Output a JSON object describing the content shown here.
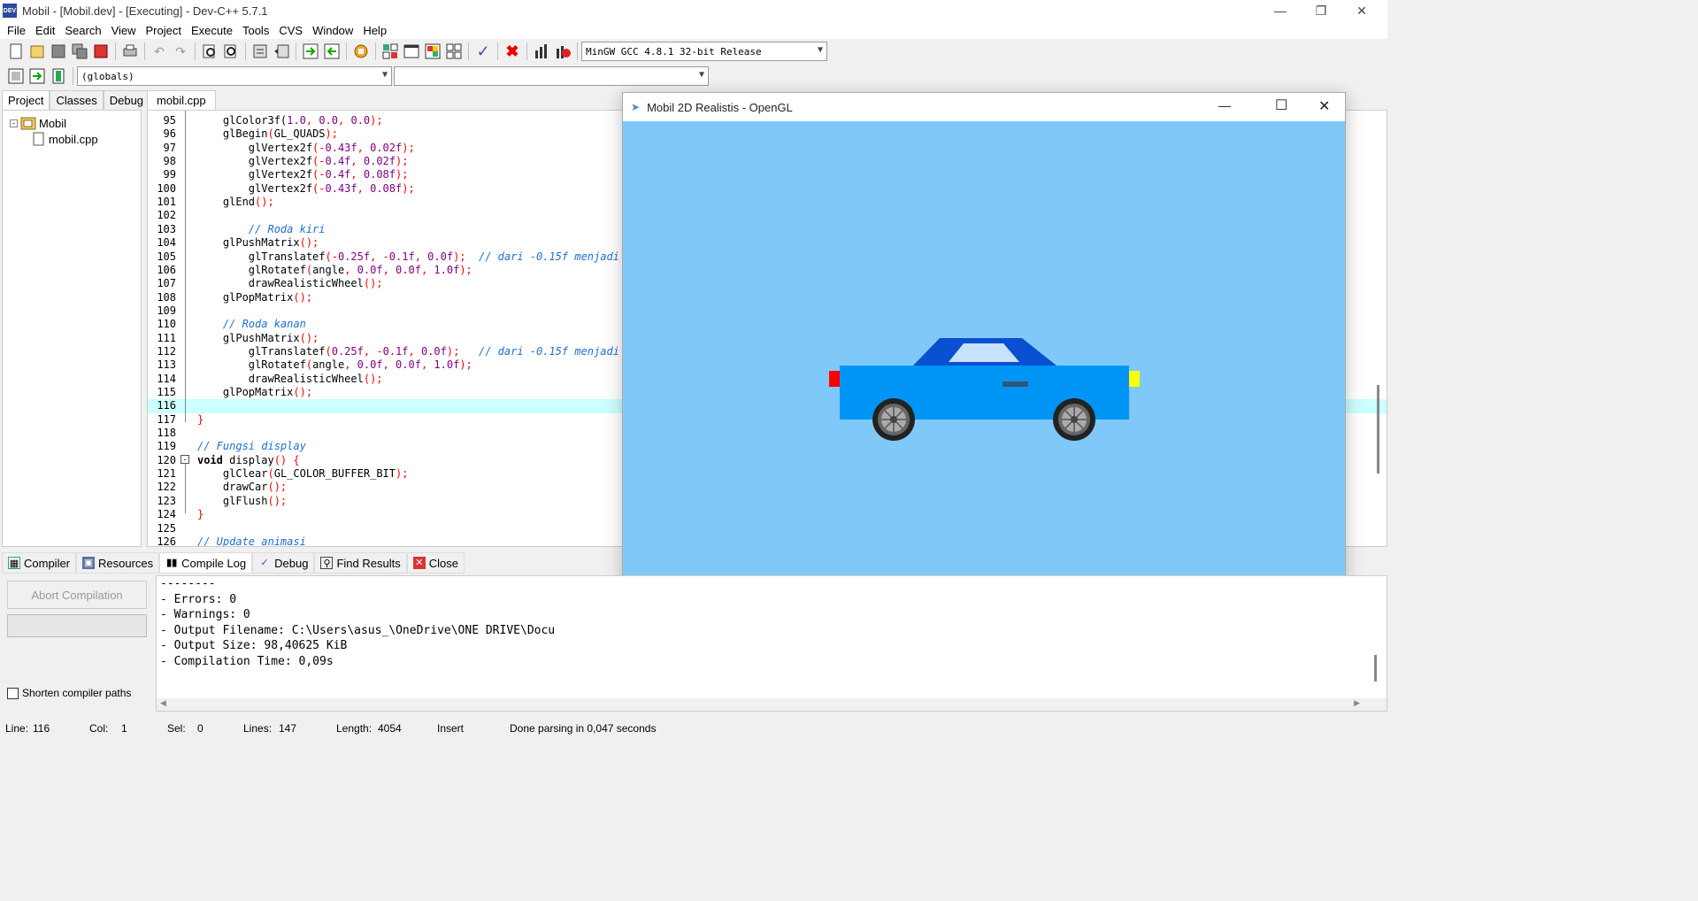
{
  "app": {
    "title": "Mobil - [Mobil.dev] - [Executing] - Dev-C++ 5.7.1",
    "icon_text": "DEV"
  },
  "window_controls": [
    "minimize-icon",
    "restore-icon",
    "close-icon"
  ],
  "menu": [
    "File",
    "Edit",
    "Search",
    "View",
    "Project",
    "Execute",
    "Tools",
    "CVS",
    "Window",
    "Help"
  ],
  "toolbar": {
    "compiler_select": "MinGW GCC 4.8.1 32-bit Release",
    "scope_select": "(globals)",
    "member_select": ""
  },
  "left_tabs": [
    "Project",
    "Classes",
    "Debug"
  ],
  "project_tree": {
    "root": "Mobil",
    "files": [
      "mobil.cpp"
    ]
  },
  "editor": {
    "tab": "mobil.cpp",
    "highlight_line": 116,
    "lines": [
      {
        "n": "95",
        "html": "    glColor3f(<span class='num'>1.0</span><span class='p'>,</span> <span class='num'>0.0</span><span class='p'>,</span> <span class='num'>0.0</span><span class='p'>);</span>"
      },
      {
        "n": "96",
        "html": "    glBegin<span class='p'>(</span>GL_QUADS<span class='p'>);</span>"
      },
      {
        "n": "97",
        "html": "        glVertex2f<span class='p'>(-</span><span class='num'>0.43f</span><span class='p'>,</span> <span class='num'>0.02f</span><span class='p'>);</span>"
      },
      {
        "n": "98",
        "html": "        glVertex2f<span class='p'>(-</span><span class='num'>0.4f</span><span class='p'>,</span> <span class='num'>0.02f</span><span class='p'>);</span>"
      },
      {
        "n": "99",
        "html": "        glVertex2f<span class='p'>(-</span><span class='num'>0.4f</span><span class='p'>,</span> <span class='num'>0.08f</span><span class='p'>);</span>"
      },
      {
        "n": "100",
        "html": "        glVertex2f<span class='p'>(-</span><span class='num'>0.43f</span><span class='p'>,</span> <span class='num'>0.08f</span><span class='p'>);</span>"
      },
      {
        "n": "101",
        "html": "    glEnd<span class='p'>();</span>"
      },
      {
        "n": "102",
        "html": ""
      },
      {
        "n": "103",
        "html": "        <span class='cm'>// Roda kiri</span>"
      },
      {
        "n": "104",
        "html": "    glPushMatrix<span class='p'>();</span>"
      },
      {
        "n": "105",
        "html": "        glTranslatef<span class='p'>(-</span><span class='num'>0.25f</span><span class='p'>,</span> <span class='p'>-</span><span class='num'>0.1f</span><span class='p'>,</span> <span class='num'>0.0f</span><span class='p'>);</span>  <span class='cm'>// dari -0.15f menjadi</span>"
      },
      {
        "n": "106",
        "html": "        glRotatef<span class='p'>(</span>angle<span class='p'>,</span> <span class='num'>0.0f</span><span class='p'>,</span> <span class='num'>0.0f</span><span class='p'>,</span> <span class='num'>1.0f</span><span class='p'>);</span>"
      },
      {
        "n": "107",
        "html": "        drawRealisticWheel<span class='p'>();</span>"
      },
      {
        "n": "108",
        "html": "    glPopMatrix<span class='p'>();</span>"
      },
      {
        "n": "109",
        "html": ""
      },
      {
        "n": "110",
        "html": "    <span class='cm'>// Roda kanan</span>"
      },
      {
        "n": "111",
        "html": "    glPushMatrix<span class='p'>();</span>"
      },
      {
        "n": "112",
        "html": "        glTranslatef<span class='p'>(</span><span class='num'>0.25f</span><span class='p'>,</span> <span class='p'>-</span><span class='num'>0.1f</span><span class='p'>,</span> <span class='num'>0.0f</span><span class='p'>);</span>   <span class='cm'>// dari -0.15f menjadi</span>"
      },
      {
        "n": "113",
        "html": "        glRotatef<span class='p'>(</span>angle<span class='p'>,</span> <span class='num'>0.0f</span><span class='p'>,</span> <span class='num'>0.0f</span><span class='p'>,</span> <span class='num'>1.0f</span><span class='p'>);</span>"
      },
      {
        "n": "114",
        "html": "        drawRealisticWheel<span class='p'>();</span>"
      },
      {
        "n": "115",
        "html": "    glPopMatrix<span class='p'>();</span>"
      },
      {
        "n": "116",
        "html": ""
      },
      {
        "n": "117",
        "html": "<span class='p'>}</span>"
      },
      {
        "n": "118",
        "html": ""
      },
      {
        "n": "119",
        "html": "<span class='cm'>// Fungsi display</span>"
      },
      {
        "n": "120",
        "html": "<span class='kw'>void</span> display<span class='p'>()</span> <span class='p'>{</span>"
      },
      {
        "n": "121",
        "html": "    glClear<span class='p'>(</span>GL_COLOR_BUFFER_BIT<span class='p'>);</span>"
      },
      {
        "n": "122",
        "html": "    drawCar<span class='p'>();</span>"
      },
      {
        "n": "123",
        "html": "    glFlush<span class='p'>();</span>"
      },
      {
        "n": "124",
        "html": "<span class='p'>}</span>"
      },
      {
        "n": "125",
        "html": ""
      },
      {
        "n": "126",
        "html": "<span class='cm'>// Update animasi</span>"
      }
    ]
  },
  "bottom_tabs": [
    {
      "label": "Compiler",
      "icon": "grid-icon"
    },
    {
      "label": "Resources",
      "icon": "resources-icon"
    },
    {
      "label": "Compile Log",
      "icon": "chart-icon"
    },
    {
      "label": "Debug",
      "icon": "check-icon"
    },
    {
      "label": "Find Results",
      "icon": "find-icon"
    },
    {
      "label": "Close",
      "icon": "close-tab-icon"
    }
  ],
  "compile": {
    "abort_button": "Abort Compilation",
    "shorten_paths_label": "Shorten compiler paths",
    "log": [
      "--------",
      "- Errors: 0",
      "- Warnings: 0",
      "- Output Filename: C:\\Users\\asus_\\OneDrive\\ONE DRIVE\\Docu",
      "- Output Size: 98,40625 KiB",
      "- Compilation Time: 0,09s"
    ]
  },
  "status": {
    "line_label": "Line:",
    "line": "116",
    "col_label": "Col:",
    "col": "1",
    "sel_label": "Sel:",
    "sel": "0",
    "lines_label": "Lines:",
    "lines": "147",
    "length_label": "Length:",
    "length": "4054",
    "mode": "Insert",
    "message": "Done parsing in 0,047 seconds"
  },
  "gl_window": {
    "title": "Mobil 2D Realistis - OpenGL",
    "background": "#80c8f8",
    "car_body_color": "#0095f5",
    "car_roof_color": "#0a4fcf",
    "window_color": "#c6e2ff",
    "tail_light_color": "#ff0000",
    "head_light_color": "#ffff00"
  }
}
